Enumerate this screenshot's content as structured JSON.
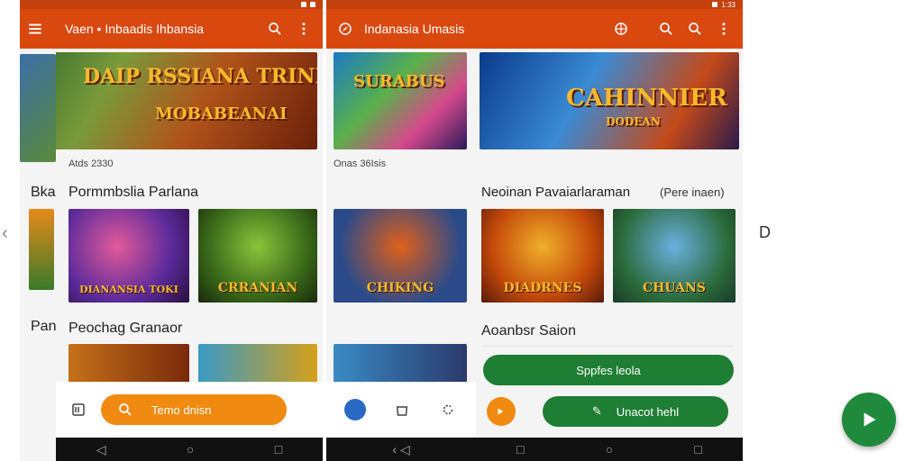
{
  "left_phone": {
    "title": "Vaen • Inbaadis Ihbansia",
    "banner_text": "DAIP RSSIANA TRINLONAK",
    "banner_sub": "MOBABEANAI",
    "caption": "Atds 2330",
    "section1": "Pormmbslia Parlana",
    "section2": "Peochag Granaor",
    "tile1": "DIANANSIA TOKI",
    "tile2": "CRRANIAN",
    "search_label": "Temo dnisn",
    "left_fragment_1": "Bkar",
    "left_fragment_2": "Pan"
  },
  "right_phone": {
    "title": "Indanasia Umasis",
    "banner1_text": "SURABUS",
    "banner2_text": "CAHINNIER",
    "banner2_sub": "DODEAN",
    "caption": "Onas 36Isis",
    "section1": "Neoinan Pavaiarlaraman",
    "section1_link": "(Pere inaen)",
    "section2": "Aoanbsr Saion",
    "tile1": "CHIKING",
    "tile2": "DIADRNES",
    "tile3": "CHUANS",
    "button1": "Sppfes leola",
    "button2": "Unacot hehl",
    "fab_icon": "play-icon"
  },
  "status": {
    "time": "1:33"
  },
  "colors": {
    "appbar": "#d9480f",
    "accent_orange": "#f08a10",
    "accent_green": "#1e7e34"
  }
}
